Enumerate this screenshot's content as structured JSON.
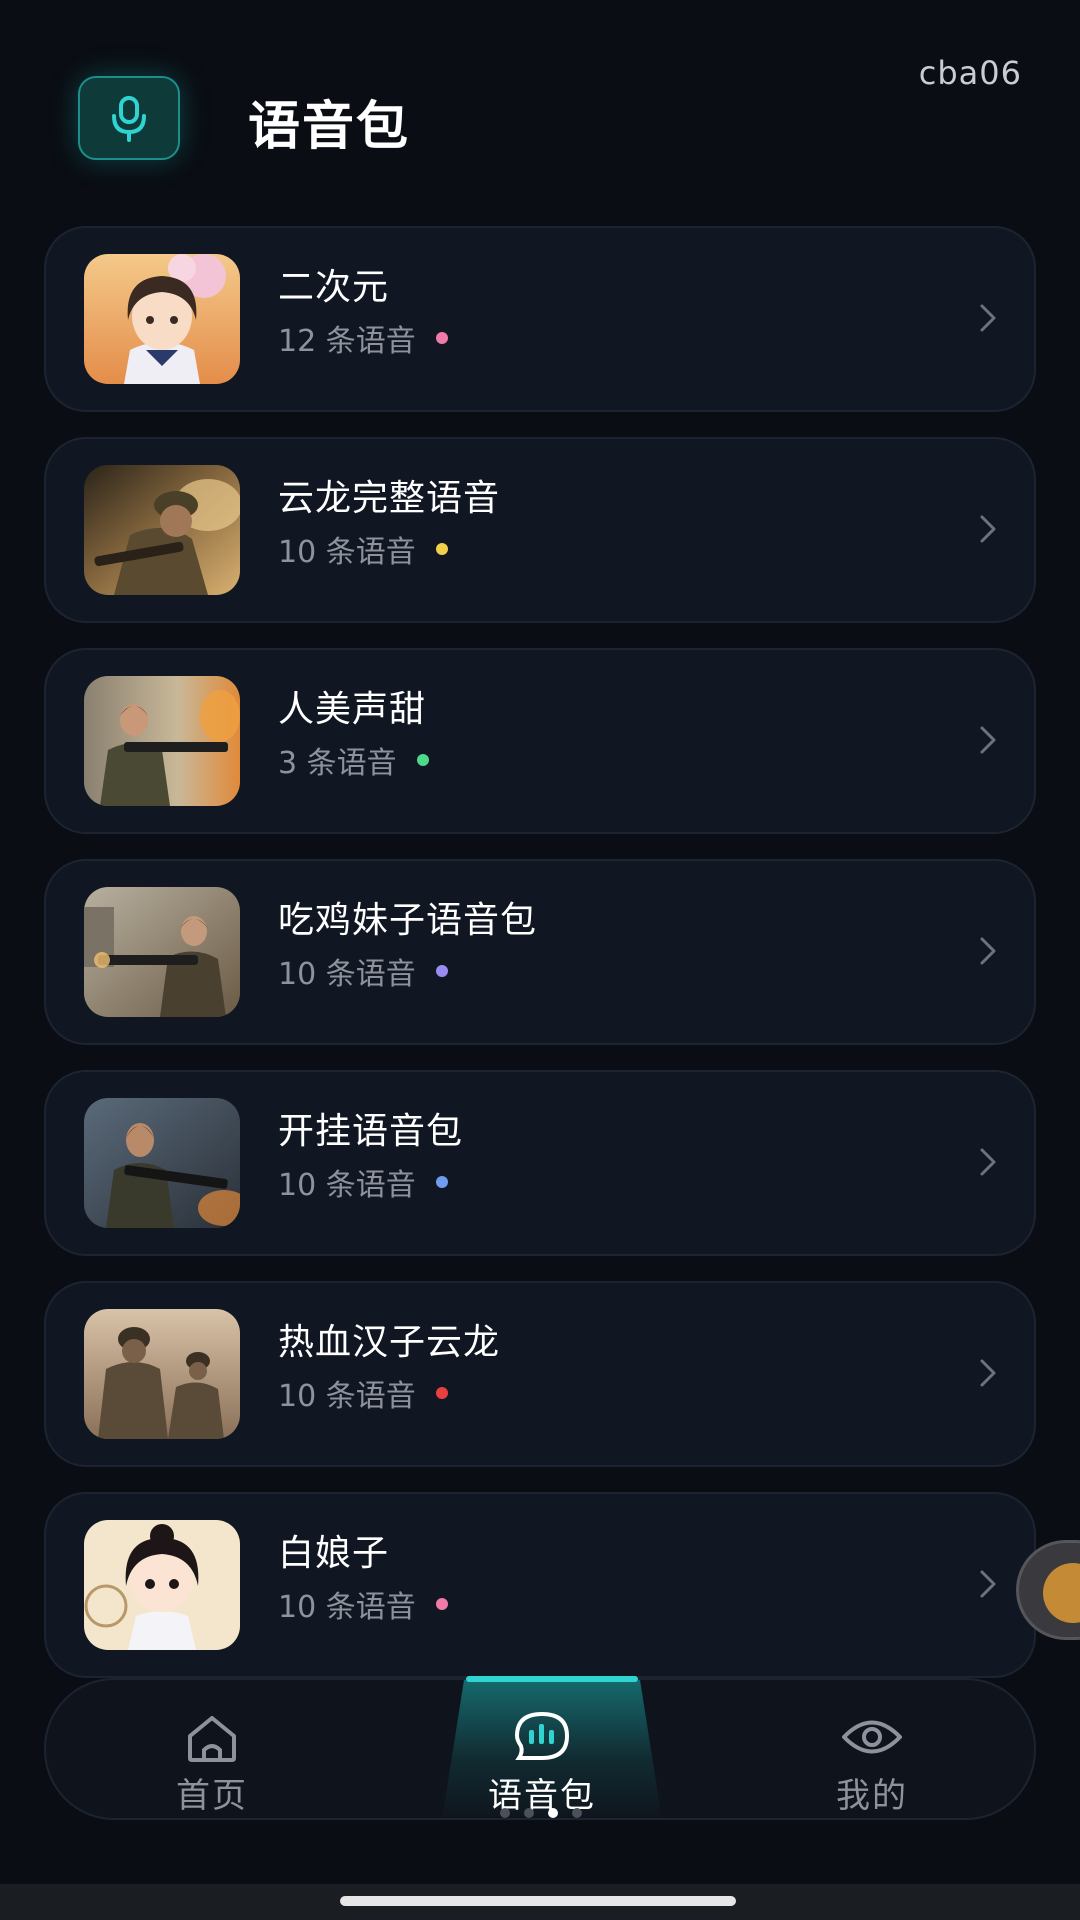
{
  "header": {
    "title": "语音包",
    "user_id": "cba06",
    "icon": "microphone-icon"
  },
  "packs": [
    {
      "title": "二次元",
      "count": "12 条语音",
      "dot_color": "#f07aa8",
      "image": "anime-girl-sailor-uniform"
    },
    {
      "title": "云龙完整语音",
      "count": "10 条语音",
      "dot_color": "#f2d04a",
      "image": "soldier-with-rifle"
    },
    {
      "title": "人美声甜",
      "count": "3 条语音",
      "dot_color": "#4cd98a",
      "image": "female-soldier-aiming"
    },
    {
      "title": "吃鸡妹子语音包",
      "count": "10 条语音",
      "dot_color": "#9b8cf0",
      "image": "female-soldier-ruins"
    },
    {
      "title": "开挂语音包",
      "count": "10 条语音",
      "dot_color": "#6f9cf0",
      "image": "female-soldier-battle"
    },
    {
      "title": "热血汉子云龙",
      "count": "10 条语音",
      "dot_color": "#e84040",
      "image": "two-soldiers"
    },
    {
      "title": "白娘子",
      "count": "10 条语音",
      "dot_color": "#f07aa8",
      "image": "chibi-hanfu-girl"
    }
  ],
  "nav": {
    "tabs": [
      {
        "label": "首页",
        "icon": "home-icon",
        "active": false
      },
      {
        "label": "语音包",
        "icon": "voice-pack-icon",
        "active": true
      },
      {
        "label": "我的",
        "icon": "eye-icon",
        "active": false
      }
    ]
  },
  "colors": {
    "accent": "#2fd3d0",
    "background": "#0a0d13",
    "card": "#111722"
  }
}
